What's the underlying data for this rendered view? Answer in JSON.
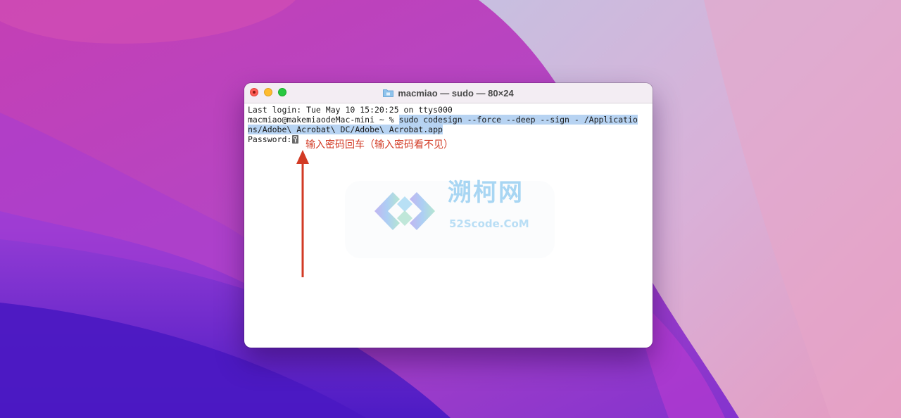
{
  "window": {
    "title": "macmiao — sudo — 80×24"
  },
  "terminal": {
    "line1": "Last login: Tue May 10 15:20:25 on ttys000",
    "line2_prompt": "macmiao@makemiaodeMac-mini ~ % ",
    "line2_command": "sudo codesign --force --deep --sign - /Applicatio",
    "line3_command": "ns/Adobe\\ Acrobat\\ DC/Adobe\\ Acrobat.app",
    "line4_prompt": "Password:"
  },
  "annotation": {
    "text": "输入密码回车（输入密码看不见）",
    "color": "#d23a24"
  },
  "watermark": {
    "cn_text": "溯柯网",
    "en_text": "52Scode.CoM"
  },
  "icons": {
    "folder": "folder-icon",
    "cursor": "key-cursor-icon",
    "arrow": "up-arrow-icon"
  },
  "colors": {
    "selection": "#b7d3f2",
    "close": "#ff5f57",
    "minimize": "#febc2e",
    "zoom": "#28c840"
  }
}
